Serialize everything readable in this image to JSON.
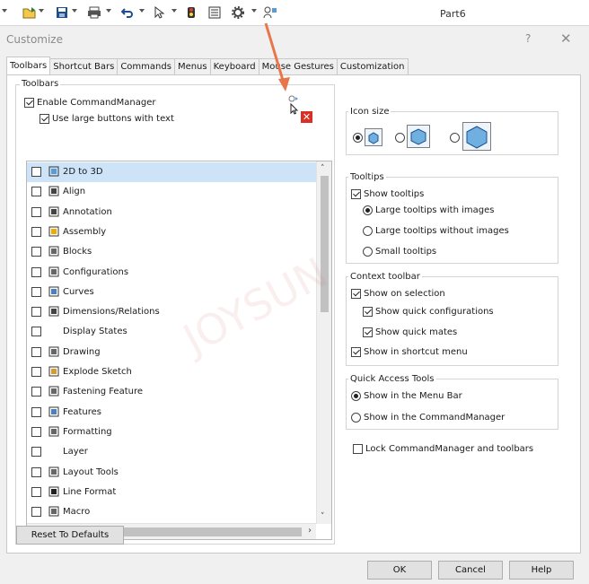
{
  "document_title": "Part6",
  "dialog": {
    "title": "Customize",
    "help_label": "?",
    "close_label": "✕"
  },
  "tabs": [
    "Toolbars",
    "Shortcut Bars",
    "Commands",
    "Menus",
    "Keyboard",
    "Mouse Gestures",
    "Customization"
  ],
  "toolbars_group": {
    "label": "Toolbars",
    "enable_commandmanager": "Enable CommandManager",
    "use_large_buttons": "Use large buttons with text"
  },
  "toolbar_list": [
    {
      "label": "2D to 3D",
      "checked": false,
      "icon": "2d-to-3d-icon"
    },
    {
      "label": "Align",
      "checked": false,
      "icon": "align-icon"
    },
    {
      "label": "Annotation",
      "checked": false,
      "icon": "annotation-icon"
    },
    {
      "label": "Assembly",
      "checked": false,
      "icon": "assembly-icon"
    },
    {
      "label": "Blocks",
      "checked": false,
      "icon": "blocks-icon"
    },
    {
      "label": "Configurations",
      "checked": false,
      "icon": "configurations-icon"
    },
    {
      "label": "Curves",
      "checked": false,
      "icon": "curves-icon"
    },
    {
      "label": "Dimensions/Relations",
      "checked": false,
      "icon": "dimensions-icon"
    },
    {
      "label": "Display States",
      "checked": false,
      "icon": ""
    },
    {
      "label": "Drawing",
      "checked": false,
      "icon": "drawing-icon"
    },
    {
      "label": "Explode Sketch",
      "checked": false,
      "icon": "explode-sketch-icon"
    },
    {
      "label": "Fastening Feature",
      "checked": false,
      "icon": "fastening-feature-icon"
    },
    {
      "label": "Features",
      "checked": false,
      "icon": "features-icon"
    },
    {
      "label": "Formatting",
      "checked": false,
      "icon": "formatting-icon"
    },
    {
      "label": "Layer",
      "checked": false,
      "icon": ""
    },
    {
      "label": "Layout Tools",
      "checked": false,
      "icon": "layout-tools-icon"
    },
    {
      "label": "Line Format",
      "checked": false,
      "icon": "line-format-icon"
    },
    {
      "label": "Macro",
      "checked": false,
      "icon": "macro-icon"
    }
  ],
  "icon_size": {
    "label": "Icon size",
    "options": [
      "small",
      "medium",
      "large"
    ],
    "selected": "small"
  },
  "tooltips": {
    "label": "Tooltips",
    "show_tooltips": "Show tooltips",
    "large_with_images": "Large tooltips with images",
    "large_without_images": "Large tooltips without images",
    "small": "Small tooltips"
  },
  "context_toolbar": {
    "label": "Context toolbar",
    "show_on_selection": "Show on selection",
    "show_quick_configurations": "Show quick configurations",
    "show_quick_mates": "Show quick mates",
    "show_in_shortcut_menu": "Show in shortcut menu"
  },
  "quick_access": {
    "label": "Quick Access Tools",
    "menu_bar": "Show in the Menu Bar",
    "commandmanager": "Show in the CommandManager"
  },
  "lock_label": "Lock CommandManager and toolbars",
  "buttons": {
    "reset": "Reset To Defaults",
    "ok": "OK",
    "cancel": "Cancel",
    "help": "Help"
  },
  "colors": {
    "selection": "#cde3f7",
    "annotation_arrow": "#e8764a",
    "delete_icon": "#d93025"
  }
}
